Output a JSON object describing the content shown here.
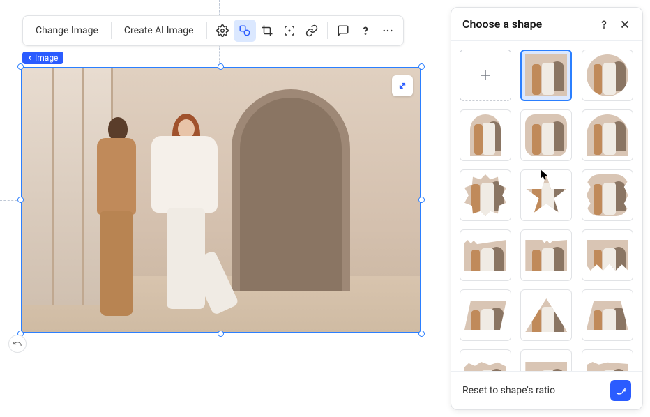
{
  "toolbar": {
    "change_image": "Change Image",
    "create_ai_image": "Create AI Image"
  },
  "badge": {
    "label": "Image"
  },
  "panel": {
    "title": "Choose a shape",
    "reset_label": "Reset to shape's ratio"
  },
  "shapes": {
    "selected_index": 1
  }
}
